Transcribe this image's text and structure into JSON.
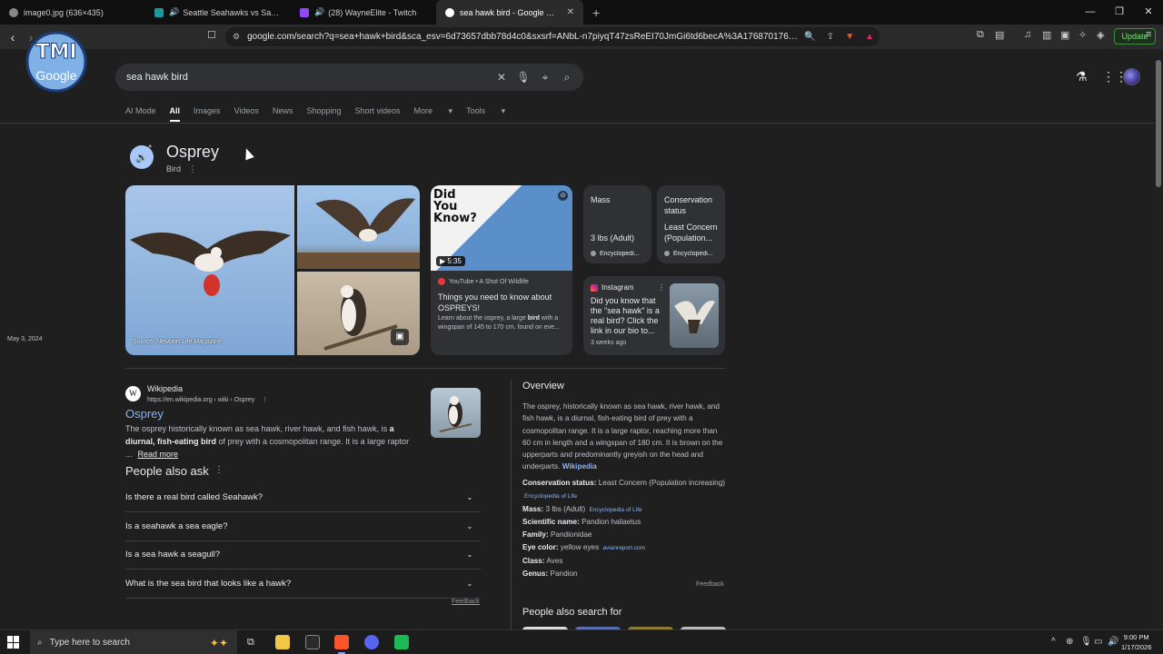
{
  "browser": {
    "tabs": [
      {
        "title": "image0.jpg (636×435)",
        "active": false
      },
      {
        "title": "Seattle Seahawks vs San Francisc",
        "active": false
      },
      {
        "title": "(28) WayneElite - Twitch",
        "active": false
      },
      {
        "title": "sea hawk bird - Google Search",
        "active": true
      }
    ],
    "url": "google.com/search?q=sea+hawk+bird&sca_esv=6d73657dbb78d4c0&sxsrf=ANbL-n7piyqT47zsReEI70JmGi6td6becA%3A1768701769936&sou...",
    "update_label": "Update"
  },
  "search": {
    "query": "sea hawk bird",
    "tabs": [
      "AI Mode",
      "All",
      "Images",
      "Videos",
      "News",
      "Shopping",
      "Short videos",
      "More",
      "Tools"
    ],
    "active_tab": "All"
  },
  "entity": {
    "title": "Osprey",
    "subtitle": "Bird",
    "image_source": "Source: Newport Life Magazine"
  },
  "video_card": {
    "duration": "5:35",
    "thumb_text": "Did You Know?",
    "source": "YouTube • A Shot Of Wildlife",
    "title": "Things you need to know about OSPREYS!",
    "desc_pre": "Learn about the osprey, a large ",
    "desc_bold": "bird",
    "desc_post": " with a wingspan of 145 to 170 cm, found on eve...",
    "date": "May 3, 2024"
  },
  "facts_cards": [
    {
      "label": "Mass",
      "value": "3 lbs (Adult)",
      "source": "Encyclopedi..."
    },
    {
      "label": "Conservation status",
      "value": "Least Concern (Population...",
      "source": "Encyclopedi..."
    }
  ],
  "instagram_card": {
    "source": "Instagram",
    "text": "Did you know that the \"sea hawk\" is a real bird? Click the link in our bio to...",
    "date": "3 weeks ago"
  },
  "wiki_result": {
    "site": "Wikipedia",
    "url": "https://en.wikipedia.org › wiki › Osprey",
    "title": "Osprey",
    "snip_a": "The osprey historically known as sea hawk, river hawk, and fish hawk, is ",
    "snip_b": "a diurnal, fish-eating bird",
    "snip_c": " of prey with a cosmopolitan range. It is a large raptor ...",
    "read_more": "Read more"
  },
  "people_also_ask": {
    "heading": "People also ask",
    "questions": [
      "Is there a real bird called Seahawk?",
      "Is a seahawk a sea eagle?",
      "Is a sea hawk a seagull?",
      "What is the sea bird that looks like a hawk?"
    ],
    "feedback": "Feedback"
  },
  "overview": {
    "heading": "Overview",
    "text": "The osprey, historically known as sea hawk, river hawk, and fish hawk, is a diurnal, fish-eating bird of prey with a cosmopolitan range. It is a large raptor, reaching more than 60 cm in length and a wingspan of 180 cm. It is brown on the upperparts and predominantly greyish on the head and underparts.",
    "link": "Wikipedia",
    "facts": [
      {
        "k": "Conservation status:",
        "v": "Least Concern (Population increasing)",
        "src": "Encyclopedia of Life"
      },
      {
        "k": "Mass:",
        "v": "3 lbs (Adult)",
        "src": "Encyclopedia of Life"
      },
      {
        "k": "Scientific name:",
        "v": "Pandion haliaetus",
        "src": ""
      },
      {
        "k": "Family:",
        "v": "Pandionidae",
        "src": ""
      },
      {
        "k": "Eye color:",
        "v": "yellow eyes",
        "src": "avianreport.com"
      },
      {
        "k": "Class:",
        "v": "Aves",
        "src": ""
      },
      {
        "k": "Genus:",
        "v": "Pandion",
        "src": ""
      }
    ],
    "feedback": "Feedback",
    "people_also_search": "People also search for"
  },
  "taskbar": {
    "search_placeholder": "Type here to search",
    "time": "9:00 PM",
    "date": "1/17/2026"
  }
}
